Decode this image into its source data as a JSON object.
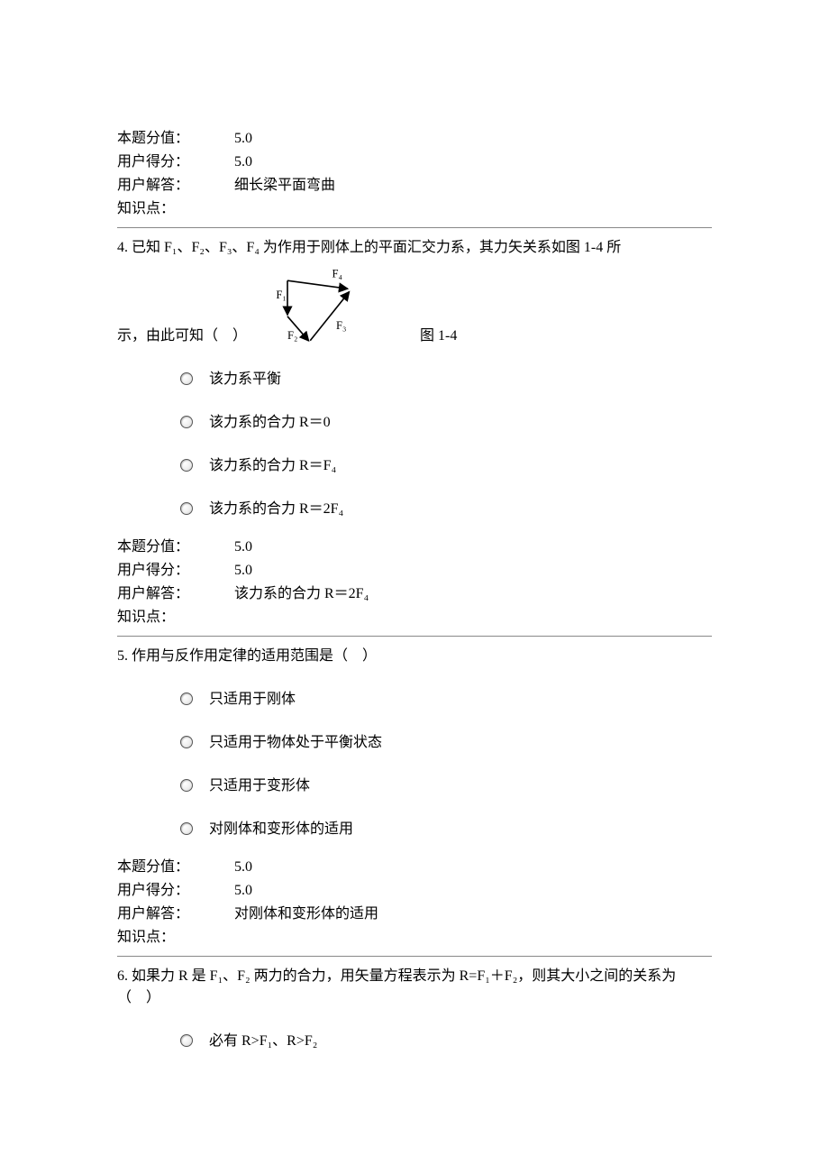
{
  "labels": {
    "score_label": "本题分值：",
    "user_score_label": "用户得分：",
    "user_answer_label": "用户解答：",
    "knowledge_label": "知识点："
  },
  "q3": {
    "score_value": "5.0",
    "user_score_value": "5.0",
    "user_answer_value": "细长梁平面弯曲",
    "knowledge_value": ""
  },
  "q4": {
    "stem_full": "4. 已知 F₁、F₂、F₃、F₄ 为作用于刚体上的平面汇交力系，其力矢关系如图 1-4 所",
    "stem_part2": "示，由此可知（　）",
    "caption": "图 1-4",
    "diagram_labels": {
      "f1": "F₁",
      "f2": "F₂",
      "f3": "F₃",
      "f4": "F₄"
    },
    "options": [
      "该力系平衡",
      "该力系的合力 R＝0",
      "该力系的合力 R＝F₄",
      "该力系的合力 R＝2F₄"
    ],
    "score_value": "5.0",
    "user_score_value": "5.0",
    "user_answer_value": "该力系的合力 R＝2F₄",
    "knowledge_value": ""
  },
  "q5": {
    "stem": "5. 作用与反作用定律的适用范围是（　）",
    "options": [
      "只适用于刚体",
      "只适用于物体处于平衡状态",
      "只适用于变形体",
      "对刚体和变形体的适用"
    ],
    "score_value": "5.0",
    "user_score_value": "5.0",
    "user_answer_value": "对刚体和变形体的适用",
    "knowledge_value": ""
  },
  "q6": {
    "stem": "6. 如果力 R 是 F₁、F₂ 两力的合力，用矢量方程表示为 R=F₁＋F₂，则其大小之间的关系为（　）",
    "options": [
      "必有 R>F₁、R>F₂"
    ]
  }
}
